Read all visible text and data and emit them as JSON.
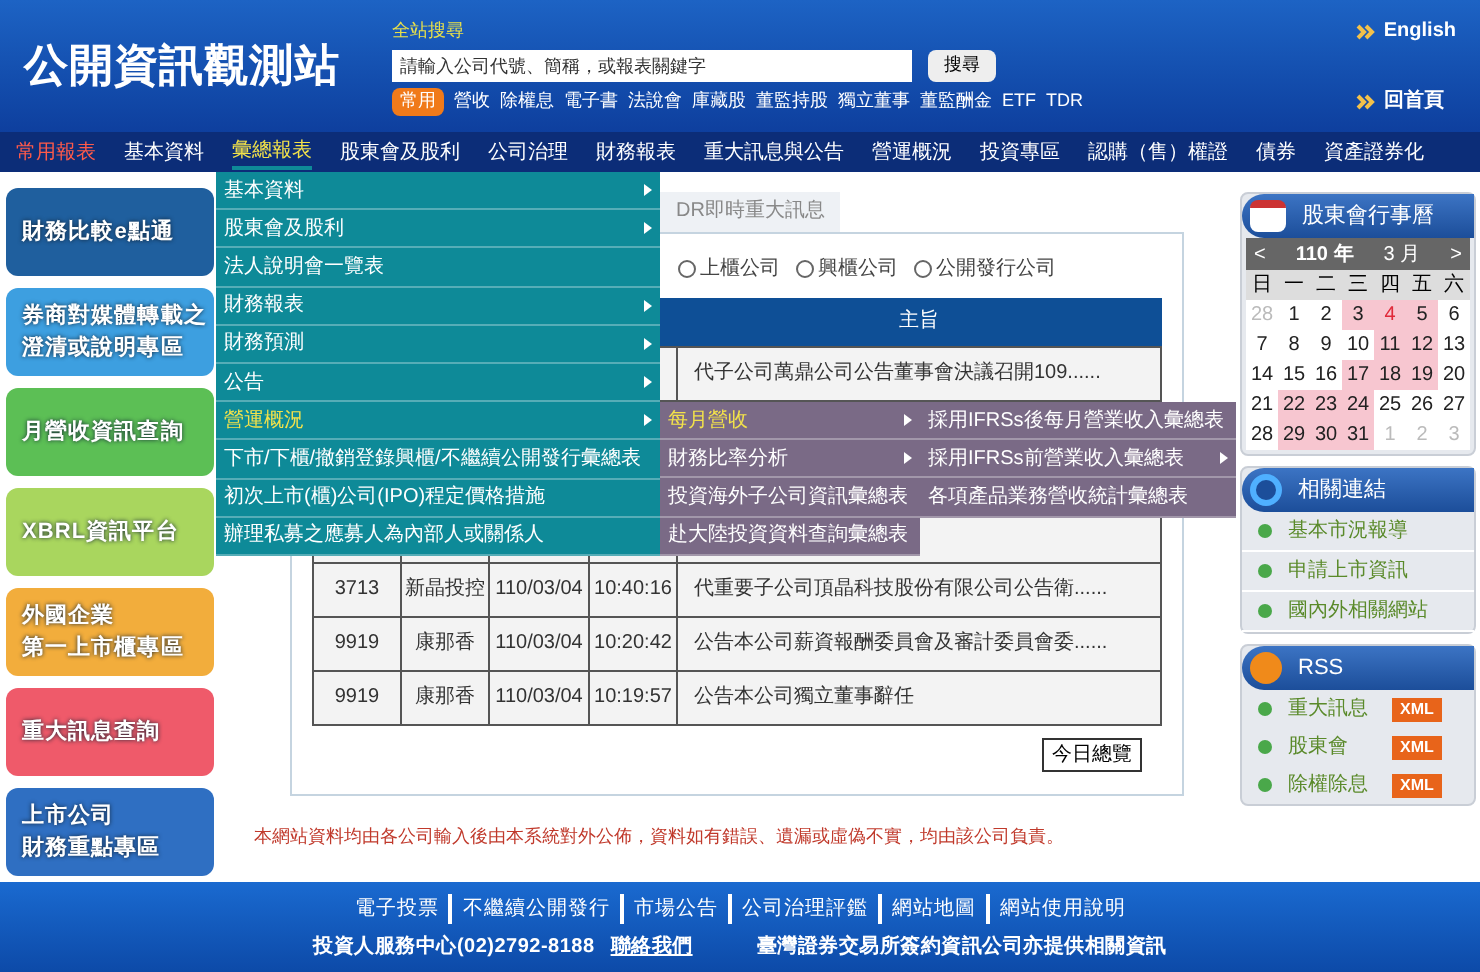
{
  "header": {
    "logo": "公開資訊觀測站",
    "search_label": "全站搜尋",
    "search": {
      "placeholder": "請輸入公司代號、簡稱，或報表關鍵字"
    },
    "search_button": "搜尋",
    "quick_badge": "常用",
    "quick_links": [
      "營收",
      "除權息",
      "電子書",
      "法說會",
      "庫藏股",
      "董監持股",
      "獨立董事",
      "董監酬金",
      "ETF",
      "TDR"
    ],
    "top_links": [
      "English",
      "回首頁"
    ]
  },
  "nav": [
    {
      "label": "常用報表",
      "kind": "featured",
      "selected": false
    },
    {
      "label": "基本資料",
      "kind": "normal",
      "selected": false
    },
    {
      "label": "彙總報表",
      "kind": "normal",
      "selected": true
    },
    {
      "label": "股東會及股利",
      "kind": "normal",
      "selected": false
    },
    {
      "label": "公司治理",
      "kind": "normal",
      "selected": false
    },
    {
      "label": "財務報表",
      "kind": "normal",
      "selected": false
    },
    {
      "label": "重大訊息與公告",
      "kind": "normal",
      "selected": false
    },
    {
      "label": "營運概況",
      "kind": "normal",
      "selected": false
    },
    {
      "label": "投資專區",
      "kind": "normal",
      "selected": false
    },
    {
      "label": "認購（售）權證",
      "kind": "normal",
      "selected": false
    },
    {
      "label": "債券",
      "kind": "normal",
      "selected": false
    },
    {
      "label": "資產證券化",
      "kind": "normal",
      "selected": false
    }
  ],
  "menu": [
    {
      "label": "基本資料",
      "has_submenu": true,
      "selected": false
    },
    {
      "label": "股東會及股利",
      "has_submenu": true,
      "selected": false
    },
    {
      "label": "法人說明會一覽表",
      "has_submenu": false,
      "selected": false
    },
    {
      "label": "財務報表",
      "has_submenu": true,
      "selected": false
    },
    {
      "label": "財務預測",
      "has_submenu": true,
      "selected": false
    },
    {
      "label": "公告",
      "has_submenu": true,
      "selected": false
    },
    {
      "label": "營運概況",
      "has_submenu": true,
      "selected": true
    },
    {
      "label": "下市/下櫃/撤銷登錄興櫃/不繼續公開發行彙總表",
      "has_submenu": false,
      "selected": false
    },
    {
      "label": "初次上市(櫃)公司(IPO)程定價格措施",
      "has_submenu": false,
      "selected": false
    },
    {
      "label": "辦理私募之應募人為內部人或關係人",
      "has_submenu": false,
      "selected": false
    }
  ],
  "submenu": [
    {
      "label": "每月營收",
      "has_submenu": true,
      "selected": true
    },
    {
      "label": "財務比率分析",
      "has_submenu": true,
      "selected": false
    },
    {
      "label": "投資海外子公司資訊彙總表",
      "has_submenu": false,
      "selected": false
    },
    {
      "label": "赴大陸投資資料查詢彙總表",
      "has_submenu": false,
      "selected": false
    }
  ],
  "subsubmenu": [
    {
      "label": "採用IFRSs後每月營業收入彙總表",
      "has_submenu": false,
      "selected": false
    },
    {
      "label": "採用IFRSs前營業收入彙總表",
      "has_submenu": true,
      "selected": false
    },
    {
      "label": "各項產品業務營收統計彙總表",
      "has_submenu": false,
      "selected": false
    }
  ],
  "banners": [
    {
      "lines": [
        "財務比較e點通"
      ],
      "color": "#1f5f9e"
    },
    {
      "lines": [
        "券商對媒體轉載之",
        "澄清或說明專區"
      ],
      "color": "#3d9fe0"
    },
    {
      "lines": [
        "月營收資訊查詢"
      ],
      "color": "#5cbf55"
    },
    {
      "lines": [
        "XBRL資訊平台"
      ],
      "color": "#a9d65e"
    },
    {
      "lines": [
        "外國企業",
        "第一上市櫃專區"
      ],
      "color": "#f2ad3c"
    },
    {
      "lines": [
        "重大訊息查詢"
      ],
      "color": "#ef5a6a"
    },
    {
      "lines": [
        "上市公司",
        "財務重點專區"
      ],
      "color": "#2f6fc2"
    }
  ],
  "tab": {
    "label": "DR即時重大訊息",
    "selected": true
  },
  "radios": [
    {
      "label": "上櫃公司",
      "selected": false
    },
    {
      "label": "興櫃公司",
      "selected": false
    },
    {
      "label": "公開發行公司",
      "selected": false
    }
  ],
  "table": {
    "subject_heading": "主旨",
    "rows": [
      {
        "subject": "代子公司萬鼎公司公告董事會決議召開109......"
      },
      {},
      {},
      {},
      {
        "code": "3713",
        "name": "新晶投控",
        "date": "110/03/04",
        "time": "10:40:16",
        "subject": "代重要子公司頂晶科技股份有限公司公告衛......"
      },
      {
        "code": "9919",
        "name": "康那香",
        "date": "110/03/04",
        "time": "10:20:42",
        "subject": "公告本公司薪資報酬委員會及審計委員會委......"
      },
      {
        "code": "9919",
        "name": "康那香",
        "date": "110/03/04",
        "time": "10:19:57",
        "subject": "公告本公司獨立董事辭任"
      }
    ]
  },
  "overview_button": "今日總覽",
  "disclaimer": "本網站資料均由各公司輸入後由本系統對外公佈，資料如有錯誤、遺漏或虛偽不實，均由該公司負責。",
  "calendar": {
    "title": "股東會行事曆",
    "prev": "<",
    "year": "110 年",
    "month": "3 月",
    "next": ">",
    "weekdays": [
      "日",
      "一",
      "二",
      "三",
      "四",
      "五",
      "六"
    ],
    "days": [
      {
        "day": "28",
        "kind": "other",
        "marked": false,
        "today": false
      },
      {
        "day": "1",
        "kind": "current",
        "marked": false,
        "today": false
      },
      {
        "day": "2",
        "kind": "current",
        "marked": false,
        "today": false
      },
      {
        "day": "3",
        "kind": "current",
        "marked": true,
        "today": false
      },
      {
        "day": "4",
        "kind": "current",
        "marked": true,
        "today": true
      },
      {
        "day": "5",
        "kind": "current",
        "marked": true,
        "today": false
      },
      {
        "day": "6",
        "kind": "current",
        "marked": false,
        "today": false
      },
      {
        "day": "7",
        "kind": "current",
        "marked": false,
        "today": false
      },
      {
        "day": "8",
        "kind": "current",
        "marked": false,
        "today": false
      },
      {
        "day": "9",
        "kind": "current",
        "marked": false,
        "today": false
      },
      {
        "day": "10",
        "kind": "current",
        "marked": false,
        "today": false
      },
      {
        "day": "11",
        "kind": "current",
        "marked": true,
        "today": false
      },
      {
        "day": "12",
        "kind": "current",
        "marked": true,
        "today": false
      },
      {
        "day": "13",
        "kind": "current",
        "marked": false,
        "today": false
      },
      {
        "day": "14",
        "kind": "current",
        "marked": false,
        "today": false
      },
      {
        "day": "15",
        "kind": "current",
        "marked": false,
        "today": false
      },
      {
        "day": "16",
        "kind": "current",
        "marked": false,
        "today": false
      },
      {
        "day": "17",
        "kind": "current",
        "marked": true,
        "today": false
      },
      {
        "day": "18",
        "kind": "current",
        "marked": true,
        "today": false
      },
      {
        "day": "19",
        "kind": "current",
        "marked": true,
        "today": false
      },
      {
        "day": "20",
        "kind": "current",
        "marked": false,
        "today": false
      },
      {
        "day": "21",
        "kind": "current",
        "marked": false,
        "today": false
      },
      {
        "day": "22",
        "kind": "current",
        "marked": true,
        "today": false
      },
      {
        "day": "23",
        "kind": "current",
        "marked": true,
        "today": false
      },
      {
        "day": "24",
        "kind": "current",
        "marked": true,
        "today": false
      },
      {
        "day": "25",
        "kind": "current",
        "marked": false,
        "today": false
      },
      {
        "day": "26",
        "kind": "current",
        "marked": false,
        "today": false
      },
      {
        "day": "27",
        "kind": "current",
        "marked": false,
        "today": false
      },
      {
        "day": "28",
        "kind": "current",
        "marked": false,
        "today": false
      },
      {
        "day": "29",
        "kind": "current",
        "marked": true,
        "today": false
      },
      {
        "day": "30",
        "kind": "current",
        "marked": true,
        "today": false
      },
      {
        "day": "31",
        "kind": "current",
        "marked": true,
        "today": false
      },
      {
        "day": "1",
        "kind": "other",
        "marked": false,
        "today": false
      },
      {
        "day": "2",
        "kind": "other",
        "marked": false,
        "today": false
      },
      {
        "day": "3",
        "kind": "other",
        "marked": false,
        "today": false
      }
    ]
  },
  "links": {
    "title": "相關連結",
    "items": [
      "基本市況報導",
      "申請上市資訊",
      "國內外相關網站"
    ]
  },
  "rss": {
    "title": "RSS",
    "items": [
      {
        "label": "重大訊息",
        "badge": "XML"
      },
      {
        "label": "股東會",
        "badge": "XML"
      },
      {
        "label": "除權除息",
        "badge": "XML"
      }
    ]
  },
  "footer": {
    "links": [
      "電子投票",
      "不繼續公開發行",
      "市場公告",
      "公司治理評鑑",
      "網站地圖",
      "網站使用說明"
    ],
    "service": "投資人服務中心(02)2792-8188",
    "contact": "聯絡我們",
    "note": "臺灣證券交易所簽約資訊公司亦提供相關資訊"
  }
}
